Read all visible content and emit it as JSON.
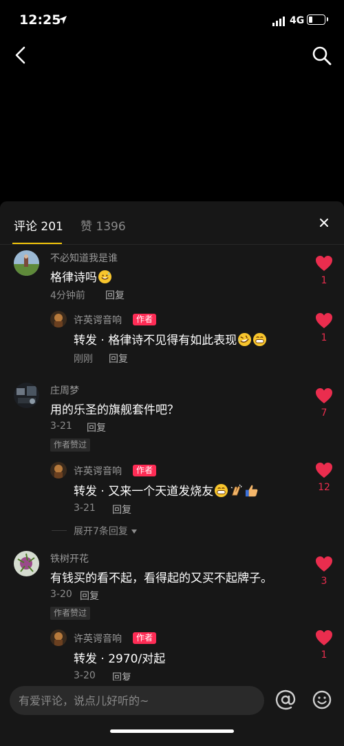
{
  "status_bar": {
    "time": "12:25",
    "network": "4G",
    "battery_level": 0.25
  },
  "nav": {
    "back_icon": "chevron-left-icon",
    "search_icon": "search-icon"
  },
  "sheet": {
    "tabs": [
      {
        "label": "评论 201",
        "active": true
      },
      {
        "label": "赞 1396",
        "active": false
      }
    ],
    "accent_color": "#f5c70a",
    "like_color": "#ea2d4e"
  },
  "comments": [
    {
      "username": "不必知道我是谁",
      "text": "格律诗吗",
      "time": "4分钟前",
      "reply_label": "回复",
      "likes": "1",
      "emojis": [
        "sweat-smile-emoji"
      ],
      "reply": {
        "username": "许英谔音响",
        "author_tag": "作者",
        "text": "转发 · 格律诗不见得有如此表现",
        "time": "刚刚",
        "reply_label": "回复",
        "likes": "1",
        "emojis": [
          "rofl-emoji",
          "grin-emoji"
        ]
      }
    },
    {
      "username": "庄周梦",
      "text": "用的乐圣的旗舰套件吧？",
      "time": "3-21",
      "reply_label": "回复",
      "author_liked": "作者赞过",
      "likes": "7",
      "reply": {
        "username": "许英谔音响",
        "author_tag": "作者",
        "text": "转发 · 又来一个天道发烧友",
        "time": "3-21",
        "reply_label": "回复",
        "likes": "12",
        "emojis": [
          "grin-emoji",
          "clap-emoji",
          "thumbs-up-emoji"
        ]
      },
      "expand_label": "展开7条回复"
    },
    {
      "username": "铁树开花",
      "text": "有钱买的看不起，看得起的又买不起牌子。",
      "time": "3-20",
      "reply_label": "回复",
      "author_liked": "作者赞过",
      "likes": "3",
      "reply": {
        "username": "许英谔音响",
        "author_tag": "作者",
        "text": "转发 · 2970/对起",
        "time": "3-20",
        "reply_label": "回复",
        "likes": "1"
      }
    }
  ],
  "input": {
    "placeholder": "有爱评论，说点儿好听的~",
    "at_icon": "at-sign-icon",
    "emoji_icon": "emoji-smile-icon"
  }
}
